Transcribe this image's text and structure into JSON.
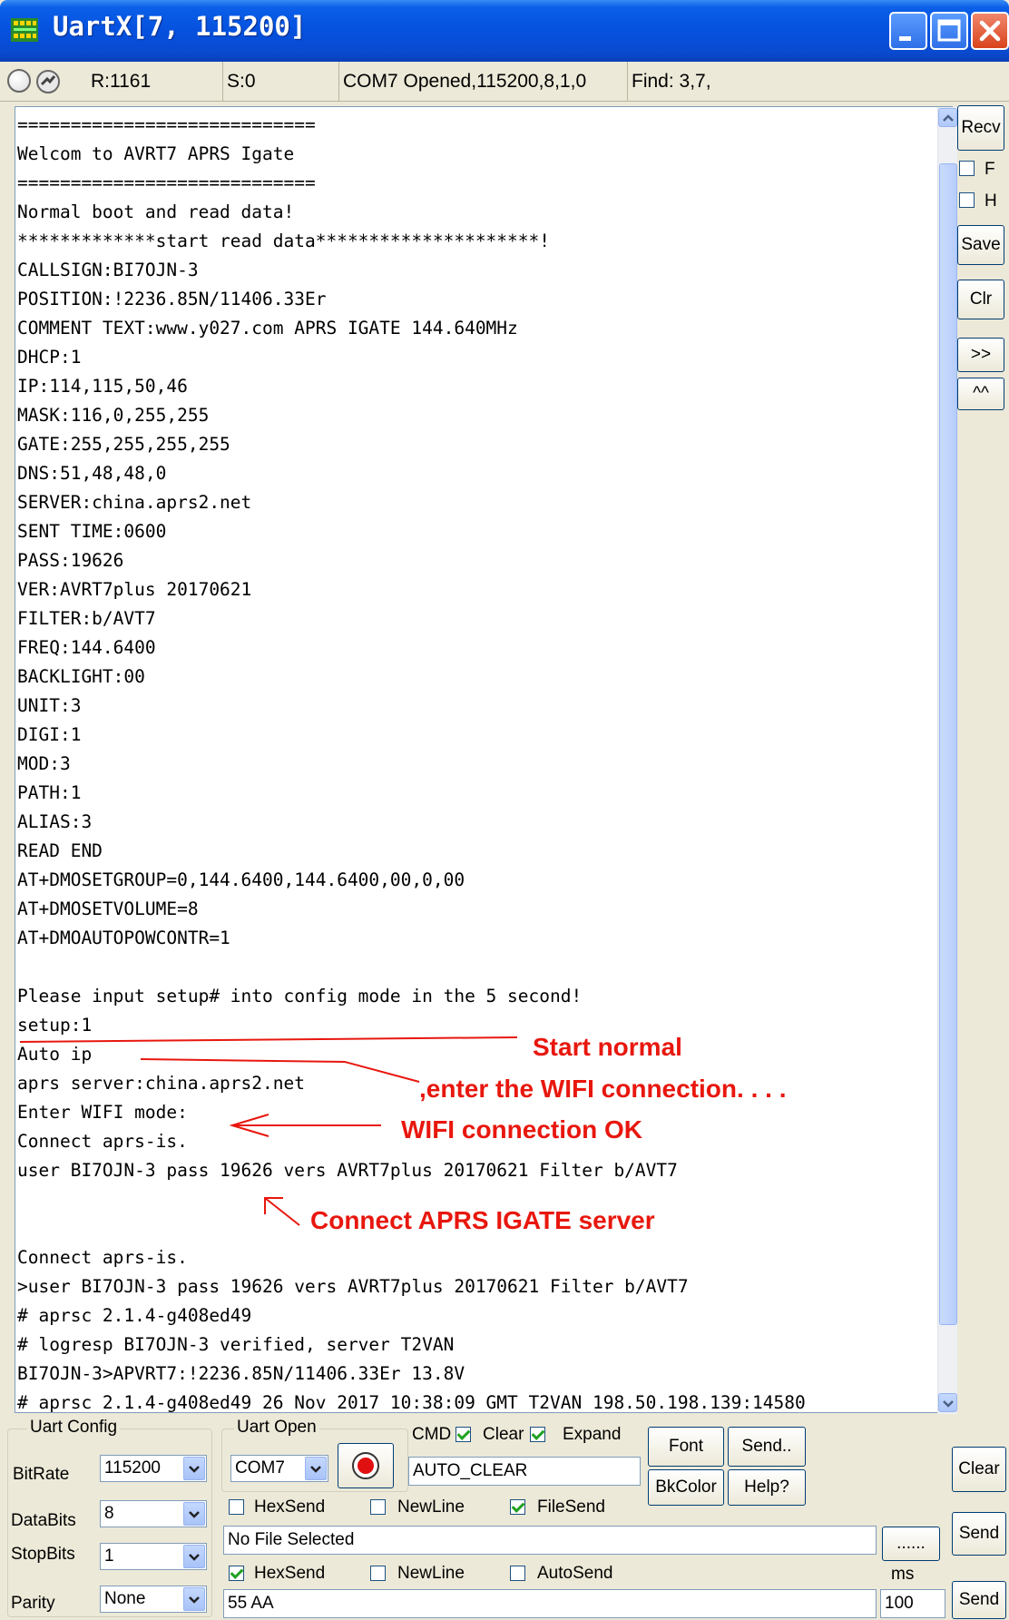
{
  "window": {
    "title": "UartX[7, 115200]"
  },
  "statusbar": {
    "r": "R:1161",
    "s": "S:0",
    "com": "COM7 Opened,115200,8,1,0",
    "find": "Find: 3,7,"
  },
  "receive": {
    "text": "============================\nWelcom to AVRT7 APRS Igate\n============================\nNormal boot and read data!\n*************start read data*********************!\nCALLSIGN:BI7OJN-3\nPOSITION:!2236.85N/11406.33Er\nCOMMENT TEXT:www.y027.com APRS IGATE 144.640MHz\nDHCP:1\nIP:114,115,50,46\nMASK:116,0,255,255\nGATE:255,255,255,255\nDNS:51,48,48,0\nSERVER:china.aprs2.net\nSENT TIME:0600\nPASS:19626\nVER:AVRT7plus 20170621\nFILTER:b/AVT7\nFREQ:144.6400\nBACKLIGHT:00\nUNIT:3\nDIGI:1\nMOD:3\nPATH:1\nALIAS:3\nREAD END\nAT+DMOSETGROUP=0,144.6400,144.6400,00,0,00\nAT+DMOSETVOLUME=8\nAT+DMOAUTOPOWCONTR=1\n\nPlease input setup# into config mode in the 5 second!\nsetup:1\nAuto ip\naprs server:china.aprs2.net\nEnter WIFI mode:\nConnect aprs-is.\nuser BI7OJN-3 pass 19626 vers AVRT7plus 20170621 Filter b/AVT7\n\n\nConnect aprs-is.\n>user BI7OJN-3 pass 19626 vers AVRT7plus 20170621 Filter b/AVT7\n# aprsc 2.1.4-g408ed49\n# logresp BI7OJN-3 verified, server T2VAN\nBI7OJN-3>APVRT7:!2236.85N/11406.33Er 13.8V\n# aprsc 2.1.4-g408ed49 26 Nov 2017 10:38:09 GMT T2VAN 198.50.198.139:14580"
  },
  "annotations": {
    "start_normal": "Start normal",
    "enter_wifi": ",enter the WIFI connection. . . .",
    "wifi_ok": "WIFI connection OK",
    "connect_igate": "Connect APRS IGATE server"
  },
  "right_panel": {
    "recv": "Recv",
    "f": "F",
    "h": "H",
    "save": "Save",
    "clr": "Clr",
    "next": ">>",
    "up": "^^"
  },
  "uart_config": {
    "title": "Uart Config",
    "bitrate_label": "BitRate",
    "bitrate": "115200",
    "databits_label": "DataBits",
    "databits": "8",
    "stopbits_label": "StopBits",
    "stopbits": "1",
    "parity_label": "Parity",
    "parity": "None"
  },
  "uart_open": {
    "title": "Uart Open",
    "port": "COM7"
  },
  "controls": {
    "cmd": "CMD",
    "clear_chk": "Clear",
    "expand": "Expand",
    "auto_clear": "AUTO_CLEAR",
    "font": "Font",
    "send_dots": "Send..",
    "bkcolor": "BkColor",
    "help": "Help?",
    "clear_btn": "Clear",
    "hexsend1": "HexSend",
    "newline1": "NewLine",
    "filesend": "FileSend",
    "file_field": "No File Selected",
    "browse": "......",
    "send1": "Send",
    "hexsend2": "HexSend",
    "newline2": "NewLine",
    "autosend": "AutoSend",
    "ms": "ms",
    "send_data": "55 AA",
    "interval": "100",
    "send2": "Send"
  },
  "colors": {
    "title_blue": "#0551de",
    "annotation_red": "#e8170e",
    "window_bg": "#ece9d8"
  }
}
